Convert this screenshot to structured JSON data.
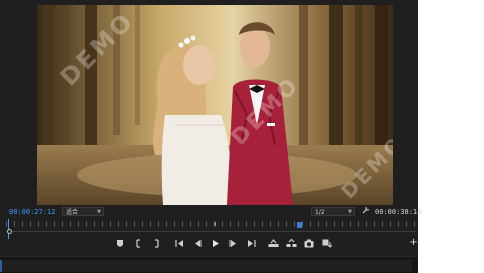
{
  "program_monitor": {
    "watermark": "DEMO",
    "current_timecode": "00:00:27:12",
    "fit_select": "适合",
    "resolution_select": "1/2",
    "duration_timecode": "00:00:38:14"
  },
  "playback": {
    "playhead_fraction": 0.005,
    "marker_fraction": 0.71
  },
  "controls": {
    "add_button": "+"
  },
  "icons": [
    "add-marker-icon",
    "mark-in-icon",
    "mark-out-icon",
    "go-to-in-icon",
    "step-back-icon",
    "play-icon",
    "step-forward-icon",
    "go-to-out-icon",
    "lift-icon",
    "extract-icon",
    "export-frame-icon",
    "button-editor-icon",
    "wrench-icon"
  ]
}
